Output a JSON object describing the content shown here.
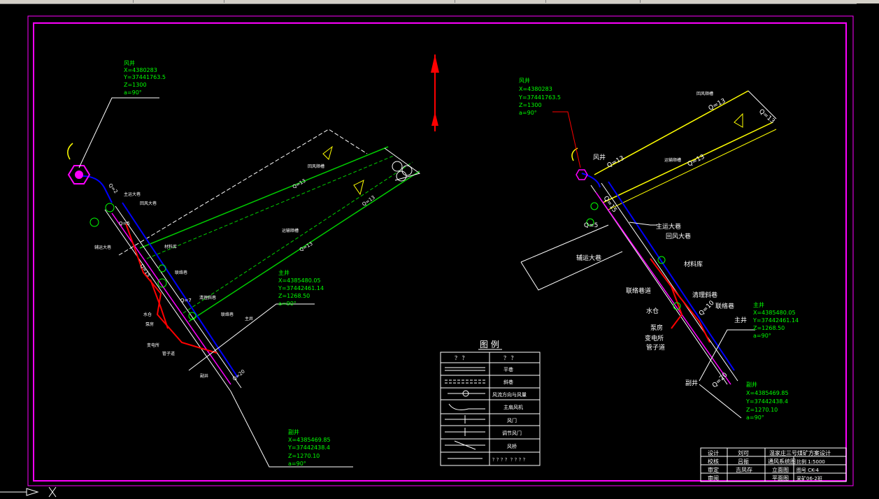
{
  "left_plan": {
    "air_shaft": {
      "title": "风井",
      "x": "X=4380283",
      "y": "Y=37441763.5",
      "z": "Z=1300",
      "a": "a=90°"
    },
    "main_shaft": {
      "title": "主井",
      "x": "X=4385480.05",
      "y": "Y=37442461.14",
      "z": "Z=1268.50",
      "a": "a=90°"
    },
    "aux_shaft": {
      "title": "副井",
      "x": "X=4385469.85",
      "y": "Y=37442438.4",
      "z": "Z=1270.10",
      "a": "a=90°"
    },
    "labels": [
      "主运大巷",
      "回风大巷",
      "辅运大巷",
      "回风顺槽",
      "运输顺槽",
      "材料库",
      "联络巷",
      "水仓",
      "泵房",
      "变电所",
      "管子道",
      "清理斜巷",
      "主井",
      "副井",
      "联络巷"
    ],
    "flow_labels": [
      "Q=13",
      "Q=13",
      "Q=13",
      "Q=5",
      "Q=7",
      "Q=15",
      "Q=20",
      "Q=2"
    ]
  },
  "right_plan": {
    "air_shaft": {
      "title": "风井",
      "x": "X=4380283",
      "y": "Y=37441763.5",
      "z": "Z=1300",
      "a": "a=90°"
    },
    "main_shaft": {
      "title": "主井",
      "x": "X=4385480.05",
      "y": "Y=37442461.14",
      "z": "Z=1268.50",
      "a": "a=90°"
    },
    "aux_shaft": {
      "title": "副井",
      "x": "X=4385469.85",
      "y": "Y=37442438.4",
      "z": "Z=1270.10",
      "a": "a=90°"
    },
    "labels": [
      "风井",
      "主运大巷",
      "回风大巷",
      "辅运大巷",
      "材料库",
      "联络巷道",
      "水仓",
      "泵房",
      "变电所",
      "管子道",
      "清理斜巷",
      "联络巷",
      "主井",
      "副井",
      "回风顺槽",
      "运输顺槽"
    ],
    "flow_labels": [
      "Q=13",
      "Q=13",
      "Q=13",
      "Q=13",
      "Q=5",
      "Q=15",
      "Q=20",
      "Q=10"
    ]
  },
  "legend": {
    "title": "图 例",
    "head_col1": "？ ？",
    "head_col2": "？ ？",
    "rows": [
      "平巷",
      "斜巷",
      "风流方向与风量",
      "主扇风机",
      "风门",
      "调节风门",
      "风桥",
      "？？？？ ？？？？",
      "？？？？ ？？？？"
    ]
  },
  "title_block": {
    "title": "温家庄三号煤矿方案设计",
    "r1": [
      "设计",
      "刘可"
    ],
    "r2": [
      "校核",
      "吕振"
    ],
    "r3": [
      "审定",
      "吉凤存"
    ],
    "r4": [
      "审阅",
      ""
    ],
    "sub1": "通风系统图",
    "sub2": "立面图",
    "sub3": "平面图",
    "scale": "比例 1:5000",
    "drawing_no": "图号 CK-4",
    "footer": "采矿06-2班"
  },
  "colors": {
    "frame": "#ff00ff",
    "shaft_label": "#00ff00",
    "intake": "#0000ff",
    "return": "#ff0000",
    "tunnel_green": "#00cc00",
    "tunnel_yellow": "#ffff00"
  },
  "icons": [
    "north-arrow-icon",
    "ucs-icon"
  ]
}
